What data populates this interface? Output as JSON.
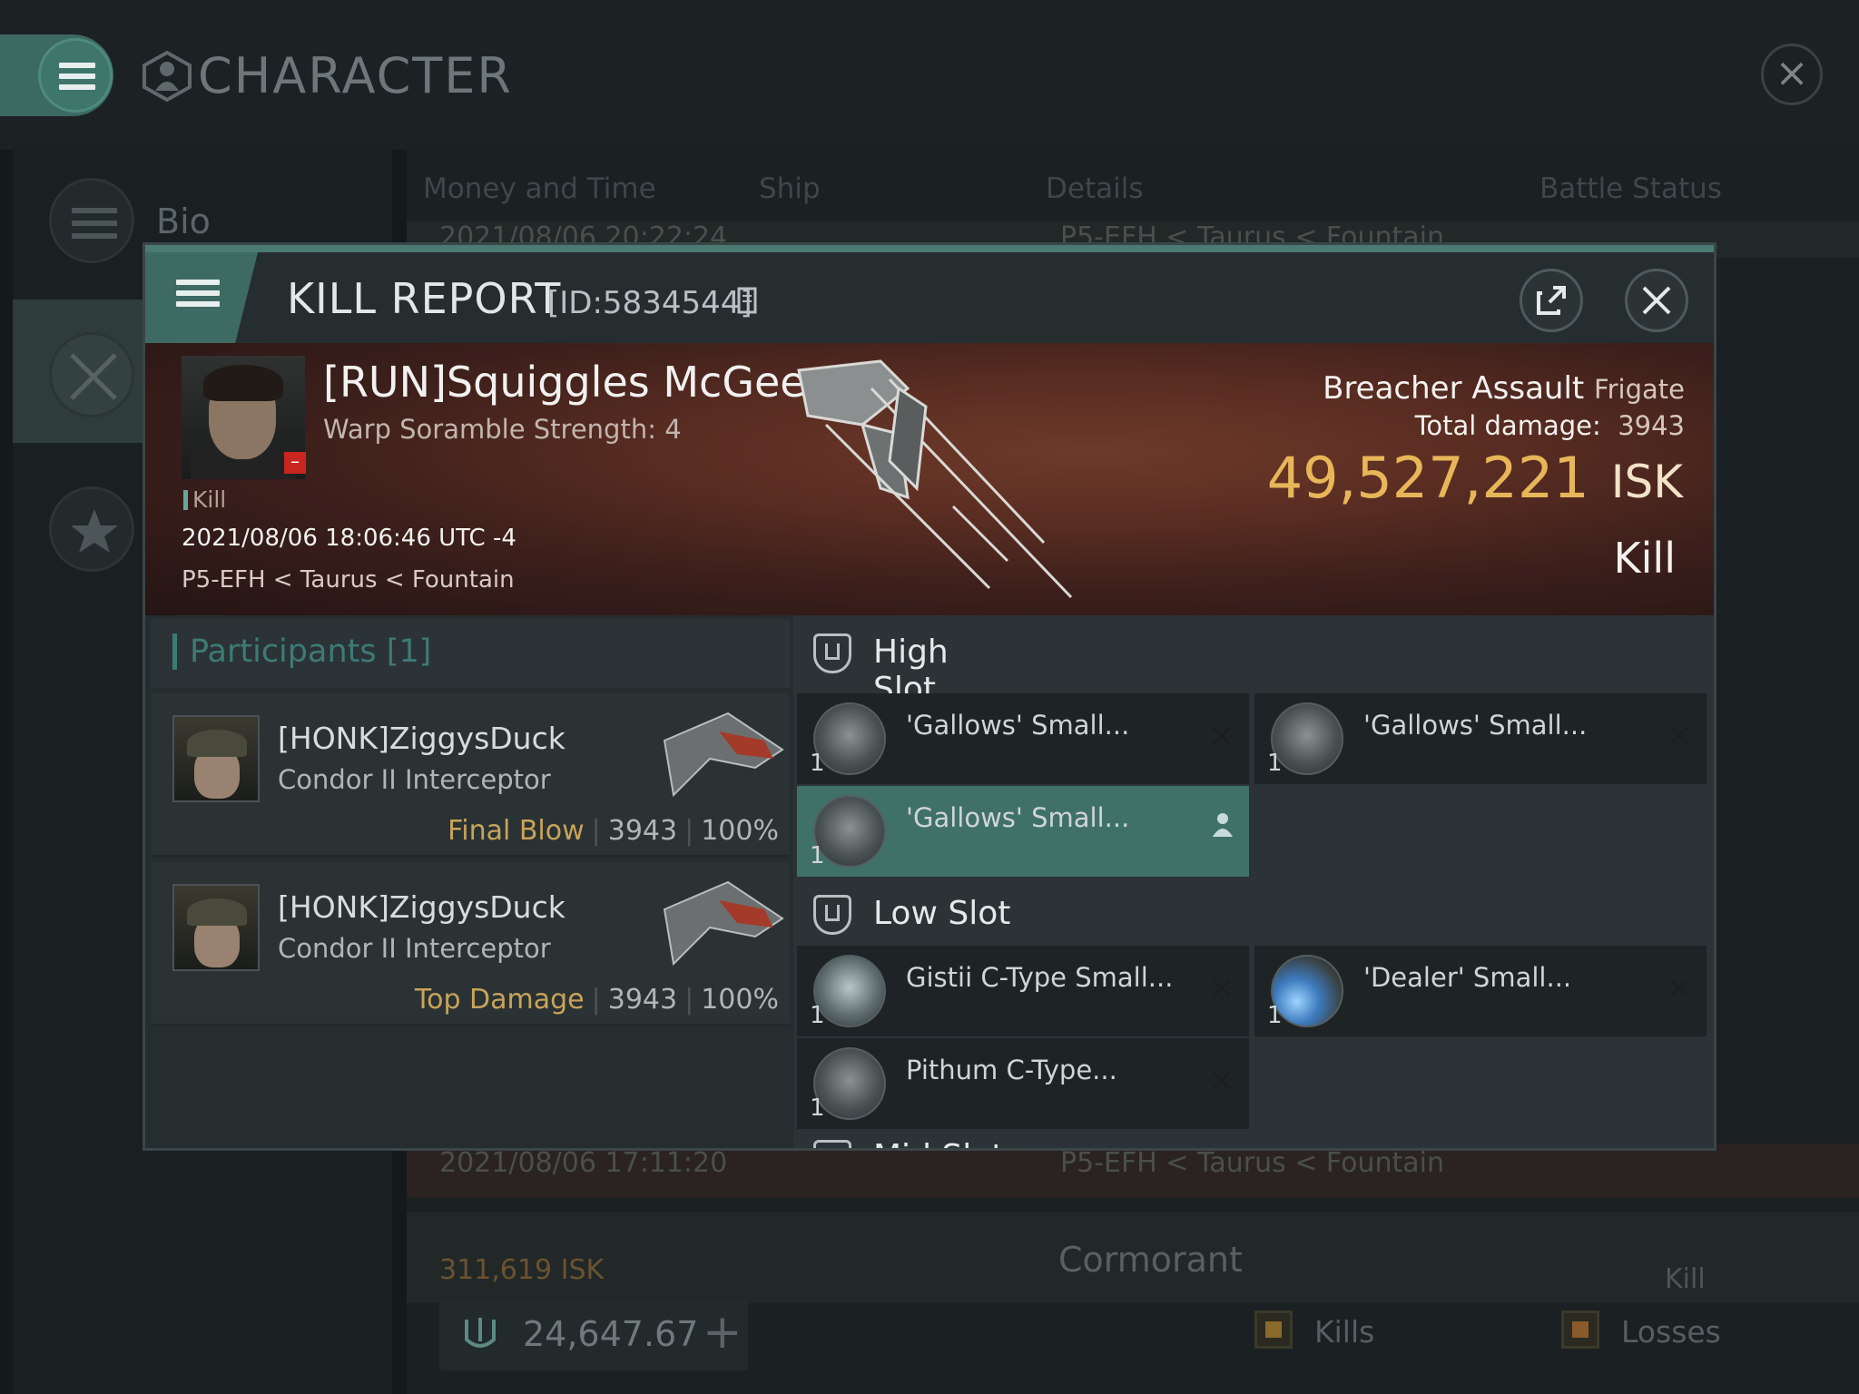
{
  "app": {
    "title": "CHARACTER",
    "menu_icon": "hamburger-icon",
    "close_icon": "close-icon"
  },
  "sidebar": {
    "items": [
      {
        "label": "Bio",
        "icon": "list-icon"
      },
      {
        "label": "",
        "icon": "crossed-swords-icon"
      },
      {
        "label": "",
        "icon": "star-icon"
      }
    ]
  },
  "background": {
    "columns": [
      "Money and Time",
      "Ship",
      "Details",
      "Battle Status"
    ],
    "row1": {
      "date": "2021/08/06  20:22:24",
      "location": "P5-EFH < Taurus < Fountain"
    },
    "row2": {
      "date": "2021/08/06  17:11:20",
      "location": "P5-EFH < Taurus < Fountain"
    },
    "row3": {
      "isk": "311,619  ISK",
      "ship": "Cormorant",
      "status": "Kill"
    },
    "wallet": "24,647.67",
    "legend": {
      "kills": "Kills",
      "losses": "Losses"
    }
  },
  "kill_report": {
    "title": "KILL REPORT",
    "id": "[ID:5834544]",
    "victim": {
      "name": "[RUN]Squiggles McGee",
      "subtitle": "Warp Soramble Strength: 4",
      "kill_tag": "Kill",
      "date": "2021/08/06 18:06:46 UTC -4",
      "location": "P5-EFH < Taurus < Fountain"
    },
    "ship": {
      "name": "Breacher Assault",
      "class": "Frigate",
      "total_damage_label": "Total damage:",
      "total_damage": "3943",
      "value": "49,527,221",
      "currency": "ISK",
      "status": "Kill"
    },
    "participants": {
      "header": "Participants [1]",
      "rows": [
        {
          "name": "[HONK]ZiggysDuck",
          "ship": "Condor II Interceptor",
          "tag": "Final Blow",
          "damage": "3943",
          "percent": "100%"
        },
        {
          "name": "[HONK]ZiggysDuck",
          "ship": "Condor II Interceptor",
          "tag": "Top Damage",
          "damage": "3943",
          "percent": "100%"
        }
      ]
    },
    "high_slot": {
      "title": "High Slot",
      "modules": [
        {
          "name": "'Gallows' Small...",
          "qty": "1",
          "state": "destroyed"
        },
        {
          "name": "'Gallows' Small...",
          "qty": "1",
          "state": "destroyed"
        },
        {
          "name": "'Gallows' Small...",
          "qty": "1",
          "state": "dropped"
        }
      ]
    },
    "low_slot": {
      "title": "Low Slot",
      "modules": [
        {
          "name": "Gistii C-Type Small...",
          "qty": "1",
          "state": "destroyed"
        },
        {
          "name": "'Dealer' Small...",
          "qty": "1",
          "state": "destroyed"
        },
        {
          "name": "Pithum C-Type...",
          "qty": "1",
          "state": "destroyed"
        }
      ]
    },
    "mid_slot": {
      "title": "Mid Slot"
    }
  }
}
